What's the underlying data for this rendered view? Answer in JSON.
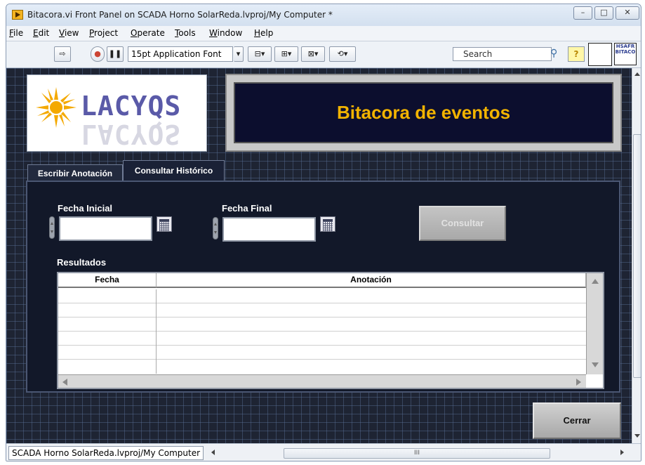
{
  "window": {
    "title": "Bitacora.vi Front Panel on SCADA Horno SolarReda.lvproj/My Computer *",
    "controls": [
      "–",
      "□",
      "✕"
    ]
  },
  "menu": [
    {
      "key": "F",
      "rest": "ile"
    },
    {
      "key": "E",
      "rest": "dit"
    },
    {
      "key": "V",
      "rest": "iew"
    },
    {
      "key": "P",
      "rest": "roject"
    },
    {
      "key": "O",
      "rest": "perate"
    },
    {
      "key": "T",
      "rest": "ools"
    },
    {
      "key": "W",
      "rest": "indow"
    },
    {
      "key": "H",
      "rest": "elp"
    }
  ],
  "toolbar": {
    "font": "15pt Application Font",
    "search_placeholder": "Search",
    "help": "?",
    "vi_icon_text": "HSAFR BITACO"
  },
  "panel": {
    "header": "Bitacora de eventos",
    "logo_text": "LACYQS",
    "tabs": [
      "Escribir Anotación",
      "Consultar Histórico"
    ],
    "fecha_inicial_label": "Fecha Inicial",
    "fecha_final_label": "Fecha Final",
    "fecha_inicial_value": "",
    "fecha_final_value": "",
    "consultar_label": "Consultar",
    "resultados_label": "Resultados",
    "table_headers": [
      "Fecha",
      "Anotación"
    ],
    "table_rows": [
      [
        "",
        ""
      ],
      [
        "",
        ""
      ],
      [
        "",
        ""
      ],
      [
        "",
        ""
      ],
      [
        "",
        ""
      ],
      [
        "",
        ""
      ]
    ],
    "cerrar_label": "Cerrar"
  },
  "status": {
    "path": "SCADA Horno SolarReda.lvproj/My Computer",
    "hscroll_grip": "III"
  },
  "colors": {
    "panel_bg": "#1e2433",
    "header_text": "#f2b300",
    "header_bg": "#0c0e2e"
  }
}
